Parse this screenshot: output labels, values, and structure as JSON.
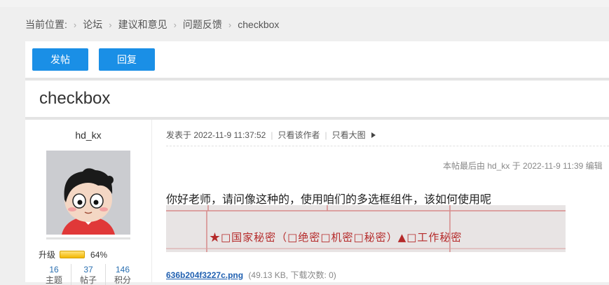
{
  "breadcrumb": {
    "prefix": "当前位置:",
    "items": [
      "论坛",
      "建议和意见",
      "问题反馈",
      "checkbox"
    ]
  },
  "toolbar": {
    "post_label": "发帖",
    "reply_label": "回复",
    "button_color": "#1a8fe6"
  },
  "thread": {
    "title": "checkbox"
  },
  "author": {
    "name": "hd_kx",
    "level_label": "升级",
    "level_percent_text": "64%",
    "level_fraction": 0.64,
    "stats": [
      {
        "value": "16",
        "label": "主题"
      },
      {
        "value": "37",
        "label": "帖子"
      },
      {
        "value": "146",
        "label": "积分"
      }
    ]
  },
  "post": {
    "posted_at": "发表于 2022-11-9 11:37:52",
    "only_author": "只看该作者",
    "large_image": "只看大图",
    "edited_note": "本帖最后由 hd_kx 于 2022-11-9 11:39 编辑",
    "body": "你好老师，请问像这种的，使用咱们的多选框组件，该如何使用呢",
    "image_text": "★□国家秘密（□绝密□机密□秘密）▲□工作秘密",
    "attachment": {
      "filename": "636b204f3227c.png",
      "info": "(49.13 KB, 下载次数: 0)"
    }
  }
}
